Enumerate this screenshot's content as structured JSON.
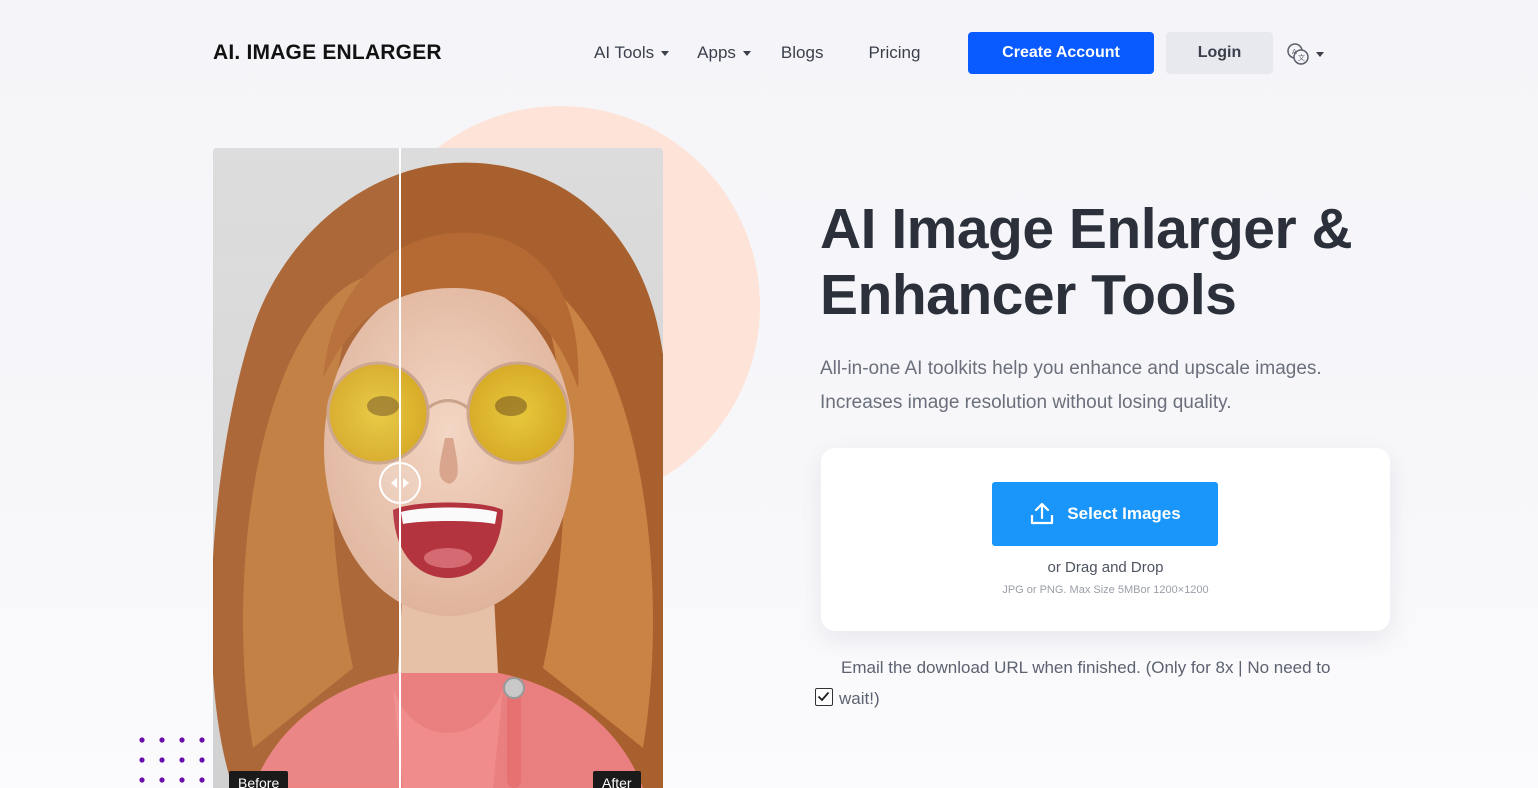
{
  "header": {
    "logo": "AI. IMAGE ENLARGER",
    "nav": [
      {
        "label": "AI Tools",
        "dropdown": true
      },
      {
        "label": "Apps",
        "dropdown": true
      },
      {
        "label": "Blogs",
        "dropdown": false
      },
      {
        "label": "Pricing",
        "dropdown": false
      }
    ],
    "create_account": "Create Account",
    "login": "Login",
    "language_icon": "translate-globe-icon"
  },
  "hero": {
    "title_line1": "AI Image Enlarger &",
    "title_line2": "Enhancer Tools",
    "subtitle_line1": "All-in-one AI toolkits help you enhance and upscale images.",
    "subtitle_line2": "Increases image resolution without losing quality."
  },
  "compare": {
    "before_label": "Before",
    "after_label": "After"
  },
  "upload": {
    "select_label": "Select Images",
    "drag_label": "or Drag and Drop",
    "hint": "JPG or PNG. Max Size 5MBor 1200×1200"
  },
  "email_option": {
    "text_line1": "Email the download URL when finished. (Only for 8x | No need to",
    "text_line2": "wait!)",
    "checked": true
  },
  "colors": {
    "primary": "#0a5bff",
    "select_button": "#1a96fa",
    "peach": "#fde3d8",
    "decor_dots": "#6a0dad"
  }
}
